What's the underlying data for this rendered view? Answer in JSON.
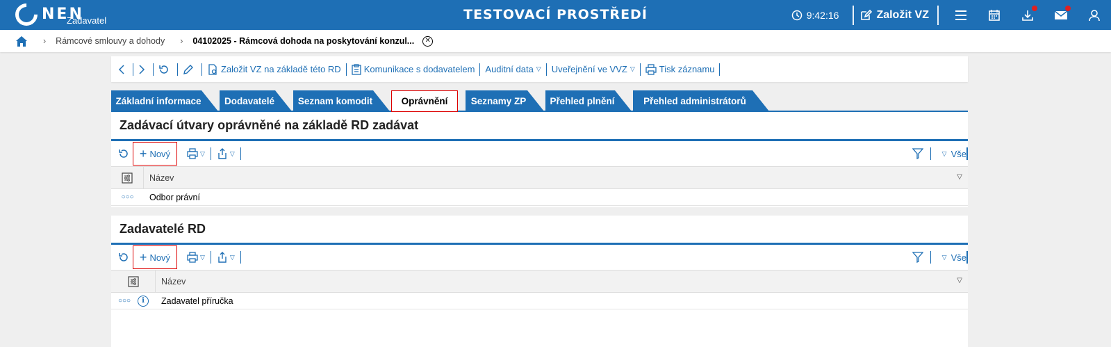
{
  "topbar": {
    "logo_text": "NEN",
    "logo_sub": "Zadavatel",
    "env_title": "TESTOVACÍ PROSTŘEDÍ",
    "time": "9:42:16",
    "create_label": "Založit VZ"
  },
  "breadcrumb": {
    "items": [
      "Rámcové smlouvy a dohody",
      "04102025 - Rámcová dohoda na poskytování konzul..."
    ]
  },
  "toolbar": {
    "create_from_rd": "Založit VZ na základě této RD",
    "communication": "Komunikace s dodavatelem",
    "audit": "Auditní data",
    "publish": "Uveřejnění ve VVZ",
    "print": "Tisk záznamu"
  },
  "tabs": [
    {
      "label": "Základní informace"
    },
    {
      "label": "Dodavatelé"
    },
    {
      "label": "Seznam komodit"
    },
    {
      "label": "Oprávnění"
    },
    {
      "label": "Seznamy ZP"
    },
    {
      "label": "Přehled plnění"
    },
    {
      "label": "Přehled administrátorů"
    }
  ],
  "section1": {
    "title": "Zadávací útvary oprávněné na základě RD zadávat",
    "new_label": "Nový",
    "all_label": "Vše",
    "column": "Název",
    "rows": [
      "Odbor právní"
    ]
  },
  "section2": {
    "title": "Zadavatelé RD",
    "new_label": "Nový",
    "all_label": "Vše",
    "column": "Název",
    "rows": [
      "Zadavatel příručka"
    ]
  },
  "colors": {
    "brand": "#1e6fb5",
    "highlight": "#dd0000",
    "badge": "#e02020"
  }
}
